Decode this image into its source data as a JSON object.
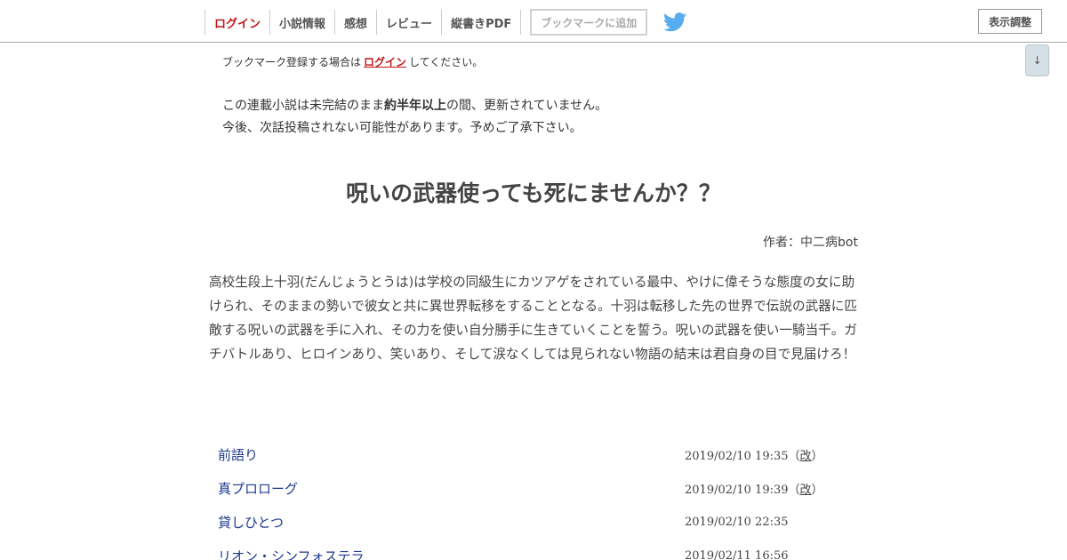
{
  "header": {
    "nav": [
      {
        "label": "ログイン"
      },
      {
        "label": "小説情報"
      },
      {
        "label": "感想"
      },
      {
        "label": "レビュー"
      },
      {
        "label": "縦書きPDF"
      }
    ],
    "bookmark_label": "ブックマークに追加",
    "display_label": "表示調整",
    "scroll_label": "↓"
  },
  "colors": {
    "accent": "#c0161b",
    "link": "#1e3a8f",
    "twitter": "#55acee"
  },
  "notice": {
    "bookmark_pre": "ブックマーク登録する場合は",
    "bookmark_link": "ログイン",
    "bookmark_post": "してください。"
  },
  "warning": {
    "line1_pre": "この連載小説は未完結のまま",
    "line1_bold": "約半年以上",
    "line1_post": "の間、更新されていません。",
    "line2": "今後、次話投稿されない可能性があります。予めご了承下さい。"
  },
  "novel": {
    "title": "呪いの武器使っても死にませんか？？",
    "author": "作者：中二病bot",
    "synopsis": "高校生段上十羽(だんじょうとうは)は学校の同級生にカツアゲをされている最中、やけに偉そうな態度の女に助けられ、そのままの勢いで彼女と共に異世界転移をすることとなる。十羽は転移した先の世界で伝説の武器に匹敵する呪いの武器を手に入れ、その力を使い自分勝手に生きていくことを誓う。呪いの武器を使い一騎当千。ガチバトルあり、ヒロインあり、笑いあり、そして涙なくしては見られない物語の結末は君自身の目で見届けろ！"
  },
  "toc": [
    {
      "title": "前語り",
      "date": "2019/02/10 19:35",
      "rev_open": "（",
      "rev": "改",
      "rev_close": "）"
    },
    {
      "title": "真プロローグ",
      "date": "2019/02/10 19:39",
      "rev_open": "（",
      "rev": "改",
      "rev_close": "）"
    },
    {
      "title": "貸しひとつ",
      "date": "2019/02/10 22:35"
    },
    {
      "title": "リオン・シンフォステラ",
      "date": "2019/02/11 16:56"
    }
  ]
}
